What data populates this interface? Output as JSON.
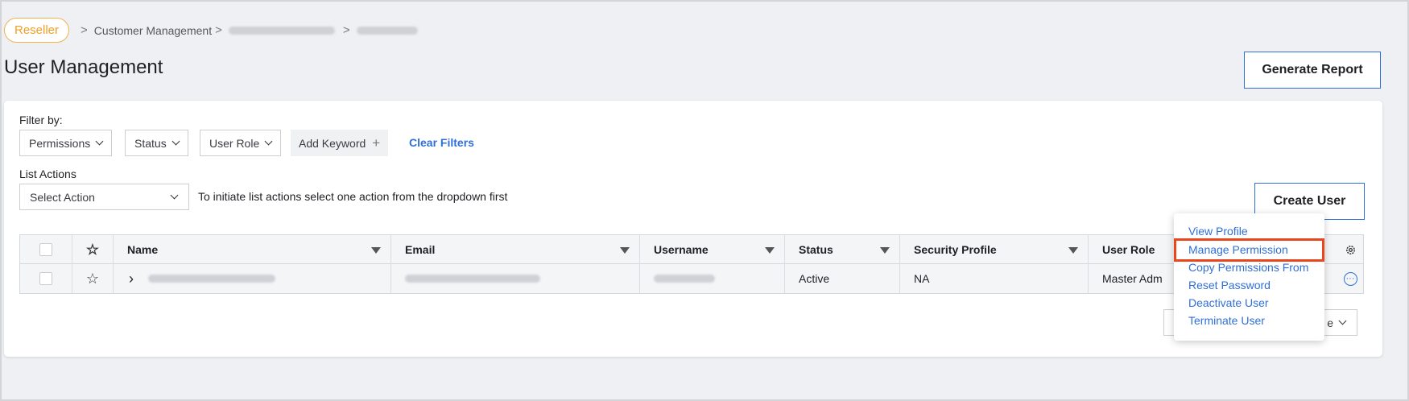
{
  "breadcrumb": {
    "badge": "Reseller",
    "items": [
      "Customer Management"
    ],
    "separator": ">"
  },
  "page": {
    "title": "User Management",
    "generate_report_label": "Generate Report"
  },
  "filters": {
    "label": "Filter by:",
    "chips": [
      "Permissions",
      "Status",
      "User Role"
    ],
    "add_keyword_label": "Add Keyword",
    "clear_label": "Clear Filters"
  },
  "list_actions": {
    "label": "List Actions",
    "select_value": "Select Action",
    "hint": "To initiate list actions select one action from the dropdown first"
  },
  "create_user_label": "Create User",
  "table": {
    "columns": [
      "Name",
      "Email",
      "Username",
      "Status",
      "Security Profile",
      "User Role"
    ],
    "rows": [
      {
        "status": "Active",
        "security_profile": "NA",
        "user_role": "Master Adm"
      }
    ]
  },
  "row_menu": {
    "items": [
      "View Profile",
      "Manage Permission",
      "Copy Permissions From",
      "Reset Password",
      "Deactivate User",
      "Terminate User"
    ],
    "highlighted": "Manage Permission"
  },
  "pager": {
    "partial_label": "e"
  },
  "colors": {
    "accent": "#2f6fd8",
    "badge": "#f0a024",
    "highlight": "#e8461d"
  }
}
